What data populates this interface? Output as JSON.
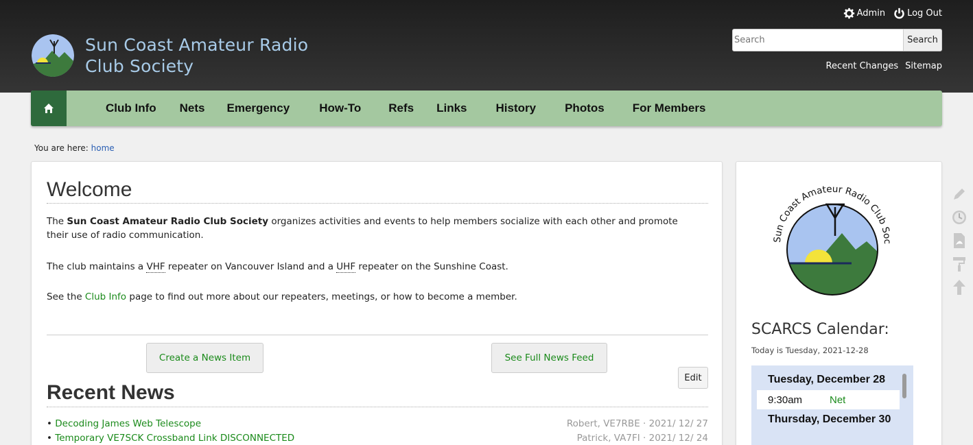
{
  "header": {
    "site_title_line1": "Sun Coast Amateur Radio",
    "site_title_line2": "Club Society",
    "user_tools": {
      "admin": "Admin",
      "logout": "Log Out"
    },
    "search": {
      "placeholder": "Search",
      "button": "Search"
    },
    "site_tools": {
      "recent_changes": "Recent Changes",
      "sitemap": "Sitemap"
    }
  },
  "nav": {
    "items": [
      "Club Info",
      "Nets",
      "Emergency",
      "How-To",
      "Refs",
      "Links",
      "History",
      "Photos",
      "For Members"
    ]
  },
  "breadcrumb": {
    "prefix": "You are here:",
    "home": "home"
  },
  "main": {
    "welcome_heading": "Welcome",
    "p1_a": "The ",
    "p1_bold": "Sun Coast Amateur Radio Club Society",
    "p1_b": " organizes activities and events to help members socialize with each other and promote their use of radio communication.",
    "p2_a": "The club maintains a ",
    "p2_vhf": "VHF",
    "p2_b": " repeater on Vancouver Island and a ",
    "p2_uhf": "UHF",
    "p2_c": " repeater on the Sunshine Coast.",
    "p3_a": "See the ",
    "p3_link": "Club Info",
    "p3_b": " page to find out more about our repeaters, meetings, or how to become a member.",
    "create_news": "Create a News Item",
    "full_feed": "See Full News Feed",
    "edit": "Edit",
    "recent_heading": "Recent News",
    "news": [
      {
        "title": "Decoding James Web Telescope",
        "meta": "Robert, VE7RBE · 2021/ 12/ 27"
      },
      {
        "title": "Temporary VE7SCK Crossband Link DISCONNECTED",
        "meta": "Patrick, VA7FI · 2021/ 12/ 24"
      }
    ]
  },
  "sidebar": {
    "logo_text": "Sun Coast Amateur Radio Club Society",
    "calendar_title": "SCARCS Calendar:",
    "today": "Today is Tuesday, 2021-12-28",
    "day1": "Tuesday, December 28",
    "event1_time": "9:30am",
    "event1_name": "Net",
    "day2": "Thursday, December 30"
  },
  "colors": {
    "header_bg": "#262626",
    "nav_bg": "#a4c8a0",
    "home_btn": "#2e6a3c",
    "link_green": "#1a8a1a",
    "title_blue": "#a8cbe8"
  }
}
